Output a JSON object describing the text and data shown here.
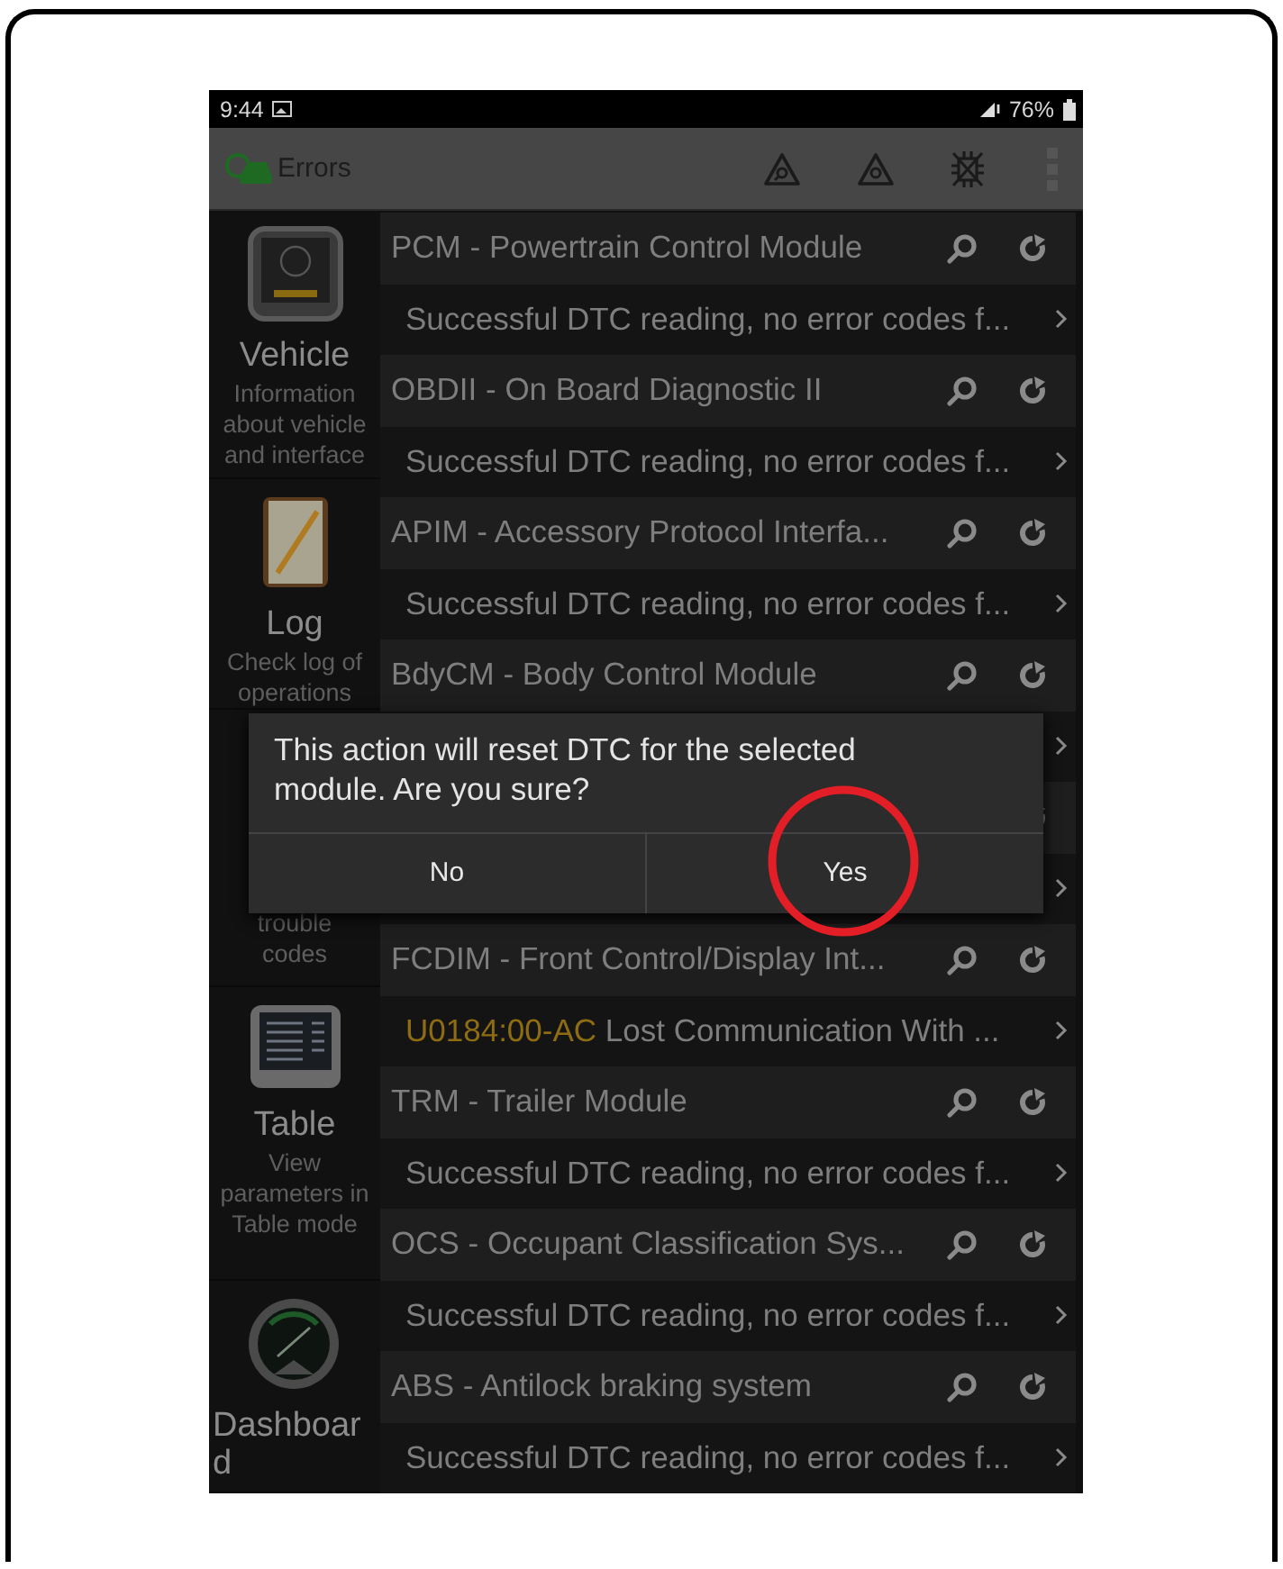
{
  "status_bar": {
    "time": "9:44",
    "battery": "76%"
  },
  "app_bar": {
    "title": "Errors"
  },
  "sidebar": {
    "items": [
      {
        "kind": "vehicle",
        "title": "Vehicle",
        "description": "Information about vehicle and interface"
      },
      {
        "kind": "log",
        "title": "Log",
        "description": "Check log of operations"
      },
      {
        "kind": "dtc",
        "description": "trouble codes"
      },
      {
        "kind": "table",
        "title": "Table",
        "description": "View parameters in Table mode"
      },
      {
        "kind": "dashboard",
        "title": "Dashboar d"
      }
    ]
  },
  "rows": [
    {
      "kind": "module",
      "name": "PCM - Powertrain Control Module"
    },
    {
      "kind": "status",
      "text": "Successful DTC reading, no error codes f..."
    },
    {
      "kind": "module",
      "name": "OBDII - On Board Diagnostic II"
    },
    {
      "kind": "status",
      "text": "Successful DTC reading, no error codes f..."
    },
    {
      "kind": "module",
      "name": "APIM - Accessory Protocol Interfa..."
    },
    {
      "kind": "status",
      "text": "Successful DTC reading, no error codes f..."
    },
    {
      "kind": "module",
      "name": "BdyCM - Body Control Module"
    },
    {
      "kind": "status"
    },
    {
      "kind": "module"
    },
    {
      "kind": "status"
    },
    {
      "kind": "module",
      "name": "FCDIM - Front Control/Display Int..."
    },
    {
      "kind": "error",
      "code": "U0184:00-AC",
      "text": "Lost Communication With ..."
    },
    {
      "kind": "module",
      "name": "TRM - Trailer Module"
    },
    {
      "kind": "status",
      "text": "Successful DTC reading, no error codes f..."
    },
    {
      "kind": "module",
      "name": "OCS - Occupant Classification Sys..."
    },
    {
      "kind": "status",
      "text": "Successful DTC reading, no error codes f..."
    },
    {
      "kind": "module",
      "name": "ABS - Antilock braking system"
    },
    {
      "kind": "status",
      "text": "Successful DTC reading, no error codes f..."
    }
  ],
  "dialog": {
    "message": "This action will reset DTC for the selected module. Are you sure?",
    "buttons": [
      {
        "label": "No",
        "circled": false
      },
      {
        "label": "Yes",
        "circled": true
      }
    ]
  }
}
